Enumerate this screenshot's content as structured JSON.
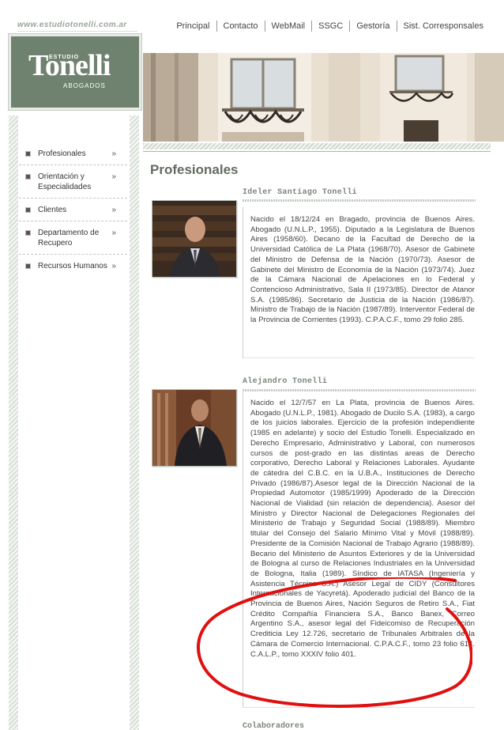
{
  "header": {
    "site_url": "www.estudiotonelli.com.ar",
    "nav": [
      "Principal",
      "Contacto",
      "WebMail",
      "SSGC",
      "Gestoría",
      "Sist. Corresponsales"
    ]
  },
  "logo": {
    "estudio": "ESTUDIO",
    "tonelli": "Tonelli",
    "abogados": "ABOGADOS"
  },
  "sidebar": {
    "items": [
      {
        "label": "Profesionales"
      },
      {
        "label": "Orientación y Especialidades"
      },
      {
        "label": "Clientes"
      },
      {
        "label": "Departamento de Recupero"
      },
      {
        "label": "Recursos Humanos"
      }
    ],
    "arrow": "»"
  },
  "main": {
    "title": "Profesionales",
    "people": [
      {
        "name": "Ideler Santiago Tonelli",
        "bio": "Nacido el 18/12/24 en Bragado, provincia de Buenos Aires. Abogado (U.N.L.P., 1955). Diputado a la Legislatura de Buenos Aires (1958/60). Decano de la Facultad de Derecho de la Universidad Católica de La Plata (1968/70). Asesor de Gabinete del Ministro de Defensa de la Nación (1970/73). Asesor de Gabinete del Ministro de Economía de la Nación (1973/74). Juez de la Cámara Nacional de Apelaciones en lo Federal y Contencioso Administrativo, Sala II (1973/85). Director de Atanor S.A. (1985/86). Secretario de Justicia de la Nación (1986/87). Ministro de Trabajo de la Nación (1987/89). Interventor Federal de la Provincia de Corrientes (1993). C.P.A.C.F., tomo 29 folio 285."
      },
      {
        "name": "Alejandro Tonelli",
        "bio": "Nacido el 12/7/57 en La Plata, provincia de Buenos Aires. Abogado (U.N.L.P., 1981). Abogado de Ducilo S.A. (1983), a cargo de los juicios laborales. Ejercicio de la profesión independiente (1985 en adelante) y socio del Estudio Tonelli. Especializado en Derecho Empresario, Administrativo y Laboral, con numerosos cursos de post-grado en las distintas areas de Derecho corporativo, Derecho Laboral y Relaciones Laborales. Ayudante de cátedra del C.B.C. en la U.B.A., Instituciones de Derecho Privado (1986/87).Asesor legal de la Dirección Nacional de la Propiedad Automotor (1985/1999) Apoderado de la Dirección Nacional de Vialidad (sin relación de dependencia). Asesor del Ministro y Director Nacional de Delegaciones Regionales del Ministerio de Trabajo y Seguridad Social (1988/89). Miembro titular del Consejo del Salario Mínimo Vital y Móvil (1988/89). Presidente de la Comisión Nacional de Trabajo Agrario (1988/89). Becario del Ministerio de Asuntos Exteriores y de la Universidad de Bologna al curso de Relaciones Industriales en la Universidad de Bologna, Italia (1989). Síndico de IATASA (Ingeniería y Asistencia Técnica S.A.) Asesor Legal de CIDY (Consultores Internacionales de Yacyretá). Apoderado judicial del Banco de la Provincia de Buenos Aires, Nación Seguros de Retiro S.A., Fiat Crédito Compañía Financiera S.A., Banco Banex, Correo Argentino S.A., asesor legal del Fideicomiso de Recuperación Crediticia Ley 12.726, secretario de Tribunales Arbitrales de la Cámara de Comercio Internacional. C.P.A.C.F., tomo 23 folio 614. C.A.L.P., tomo XXXIV folio 401."
      }
    ],
    "colaboradores": "Colaboradores"
  },
  "colors": {
    "logo_bg": "#6f826f",
    "title": "#616b61",
    "annotation_red": "#e01010"
  }
}
